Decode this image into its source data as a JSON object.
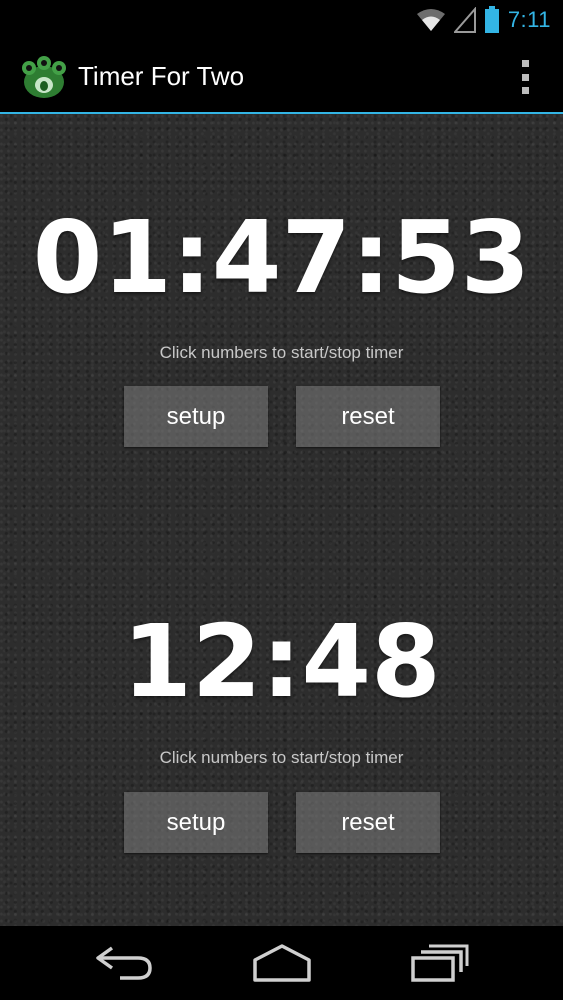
{
  "status_bar": {
    "time": "7:11",
    "icons": [
      "wifi-icon",
      "signal-icon",
      "battery-icon"
    ],
    "accent_color": "#33b5e5"
  },
  "action_bar": {
    "title": "Timer For Two",
    "app_icon": "frog-icon",
    "menu_icon": "overflow-menu-icon"
  },
  "timers": [
    {
      "display": "01:47:53",
      "hint": "Click numbers to start/stop timer",
      "setup_label": "setup",
      "reset_label": "reset"
    },
    {
      "display": "12:48",
      "hint": "Click numbers to start/stop timer",
      "setup_label": "setup",
      "reset_label": "reset"
    }
  ],
  "nav_bar": {
    "icons": [
      "back-icon",
      "home-icon",
      "recent-apps-icon"
    ]
  }
}
